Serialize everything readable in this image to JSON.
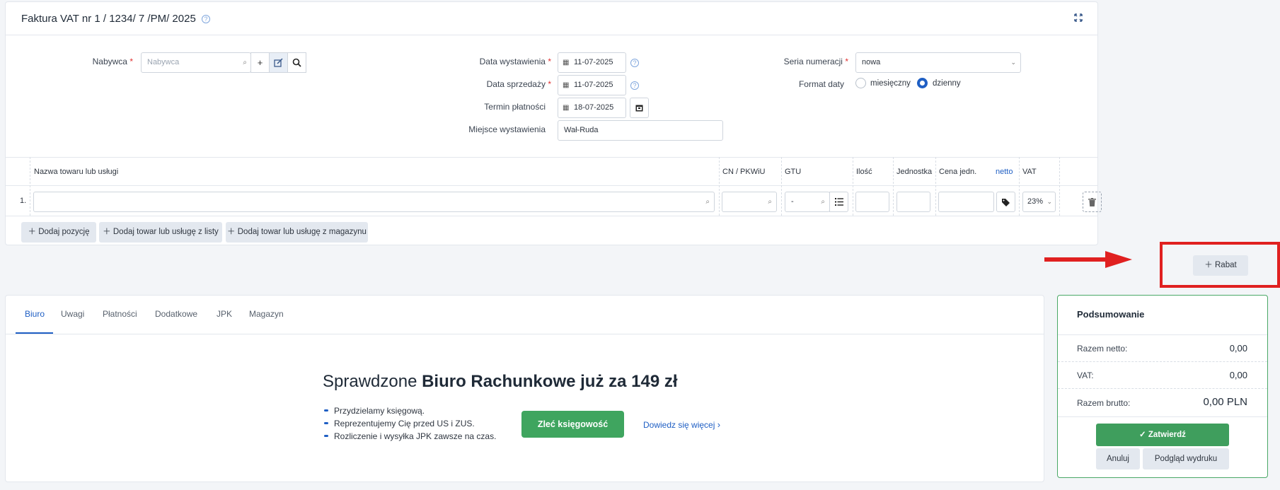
{
  "header": {
    "title": "Faktura VAT nr 1 / 1234/ 7 /PM/ 2025",
    "help_icon": "?"
  },
  "form": {
    "buyer_label": "Nabywca",
    "buyer_placeholder": "Nabywca",
    "issue_date_label": "Data wystawienia",
    "issue_date_value": "11-07-2025",
    "sale_date_label": "Data sprzedaży",
    "sale_date_value": "11-07-2025",
    "payment_term_label": "Termin płatności",
    "payment_term_value": "18-07-2025",
    "place_label": "Miejsce wystawienia",
    "place_value": "Wał-Ruda",
    "series_label": "Seria numeracji",
    "series_value": "nowa",
    "date_format_label": "Format daty",
    "date_format_options": [
      "miesięczny",
      "dzienny"
    ],
    "date_format_selected": "dzienny"
  },
  "items_table": {
    "headers": {
      "name": "Nazwa towaru lub usługi",
      "cn": "CN / PKWiU",
      "gtu": "GTU",
      "qty": "Ilość",
      "unit": "Jednostka",
      "price": "Cena jedn.",
      "netto": "netto",
      "vat": "VAT"
    },
    "rows": [
      {
        "index": "1.",
        "gtu_value": "-",
        "vat_value": "23%"
      }
    ]
  },
  "actions": {
    "add_position": "Dodaj pozycję",
    "add_from_list": "Dodaj towar lub usługę z listy",
    "add_from_warehouse": "Dodaj towar lub usługę z magazynu",
    "discount": "Rabat"
  },
  "tabs": [
    "Biuro",
    "Uwagi",
    "Płatności",
    "Dodatkowe",
    "JPK",
    "Magazyn"
  ],
  "active_tab": "Biuro",
  "promo": {
    "headline_prefix": "Sprawdzone ",
    "headline_bold": "Biuro Rachunkowe już za 149 zł",
    "bullets": [
      "Przydzielamy księgową.",
      "Reprezentujemy Cię przed US i ZUS.",
      "Rozliczenie i wysyłka JPK zawsze na czas."
    ],
    "cta": "Zleć księgowość",
    "more_link": "Dowiedz się więcej"
  },
  "summary": {
    "title": "Podsumowanie",
    "net_label": "Razem netto:",
    "net_value": "0,00",
    "vat_label": "VAT:",
    "vat_value": "0,00",
    "gross_label": "Razem brutto:",
    "gross_value": "0,00 PLN",
    "confirm": "Zatwierdź",
    "cancel": "Anuluj",
    "preview": "Podgląd wydruku"
  },
  "colors": {
    "accent_blue": "#1f5fc4",
    "confirm_green": "#3f9e5d",
    "cta_green": "#3fa55f",
    "summary_border": "#4aa866",
    "annotation_red": "#e02020"
  }
}
